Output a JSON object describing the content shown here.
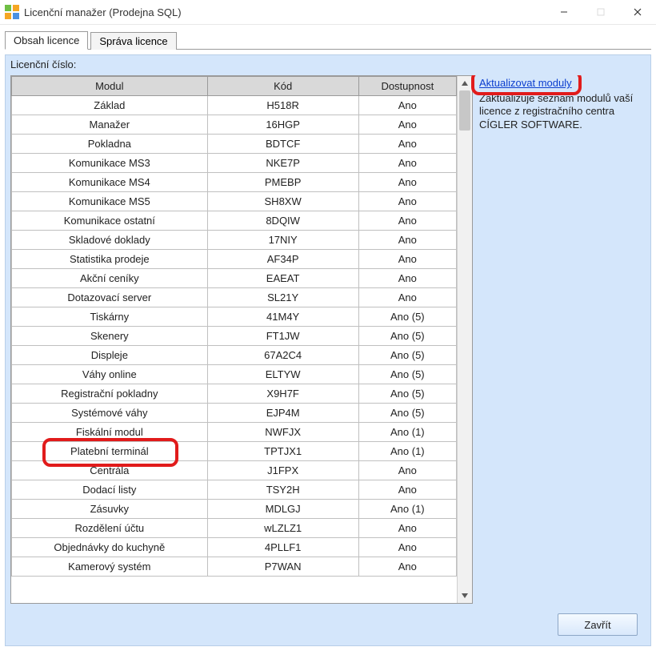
{
  "window": {
    "title": "Licenční manažer (Prodejna SQL)"
  },
  "tabs": [
    {
      "label": "Obsah licence",
      "active": true
    },
    {
      "label": "Správa licence",
      "active": false
    }
  ],
  "license_label": "Licenční číslo:",
  "table": {
    "headers": {
      "module": "Modul",
      "code": "Kód",
      "availability": "Dostupnost"
    },
    "rows": [
      {
        "module": "Základ",
        "code": "H518R",
        "avail": "Ano"
      },
      {
        "module": "Manažer",
        "code": "16HGP",
        "avail": "Ano"
      },
      {
        "module": "Pokladna",
        "code": "BDTCF",
        "avail": "Ano"
      },
      {
        "module": "Komunikace MS3",
        "code": "NKE7P",
        "avail": "Ano"
      },
      {
        "module": "Komunikace MS4",
        "code": "PMEBP",
        "avail": "Ano"
      },
      {
        "module": "Komunikace MS5",
        "code": "SH8XW",
        "avail": "Ano"
      },
      {
        "module": "Komunikace ostatní",
        "code": "8DQIW",
        "avail": "Ano"
      },
      {
        "module": "Skladové doklady",
        "code": "17NIY",
        "avail": "Ano"
      },
      {
        "module": "Statistika prodeje",
        "code": "AF34P",
        "avail": "Ano"
      },
      {
        "module": "Akční ceníky",
        "code": "EAEAT",
        "avail": "Ano"
      },
      {
        "module": "Dotazovací server",
        "code": "SL21Y",
        "avail": "Ano"
      },
      {
        "module": "Tiskárny",
        "code": "41M4Y",
        "avail": "Ano (5)"
      },
      {
        "module": "Skenery",
        "code": "FT1JW",
        "avail": "Ano (5)"
      },
      {
        "module": "Displeje",
        "code": "67A2C4",
        "avail": "Ano (5)"
      },
      {
        "module": "Váhy online",
        "code": "ELTYW",
        "avail": "Ano (5)"
      },
      {
        "module": "Registrační pokladny",
        "code": "X9H7F",
        "avail": "Ano (5)"
      },
      {
        "module": "Systémové váhy",
        "code": "EJP4M",
        "avail": "Ano (5)"
      },
      {
        "module": "Fiskální modul",
        "code": "NWFJX",
        "avail": "Ano (1)"
      },
      {
        "module": "Platební terminál",
        "code": "TPTJX1",
        "avail": "Ano (1)"
      },
      {
        "module": "Centrála",
        "code": "J1FPX",
        "avail": "Ano"
      },
      {
        "module": "Dodací listy",
        "code": "TSY2H",
        "avail": "Ano"
      },
      {
        "module": "Zásuvky",
        "code": "MDLGJ",
        "avail": "Ano (1)"
      },
      {
        "module": "Rozdělení účtu",
        "code": "wLZLZ1",
        "avail": "Ano"
      },
      {
        "module": "Objednávky do kuchyně",
        "code": "4PLLF1",
        "avail": "Ano"
      },
      {
        "module": "Kamerový systém",
        "code": "P7WAN",
        "avail": "Ano"
      }
    ]
  },
  "side": {
    "update_link": "Aktualizovat moduly",
    "desc_line1": "Zaktualizuje seznam modulů vaší",
    "desc_line2": "licence z registračního centra",
    "desc_line3": "CÍGLER SOFTWARE."
  },
  "footer": {
    "close": "Zavřít"
  }
}
